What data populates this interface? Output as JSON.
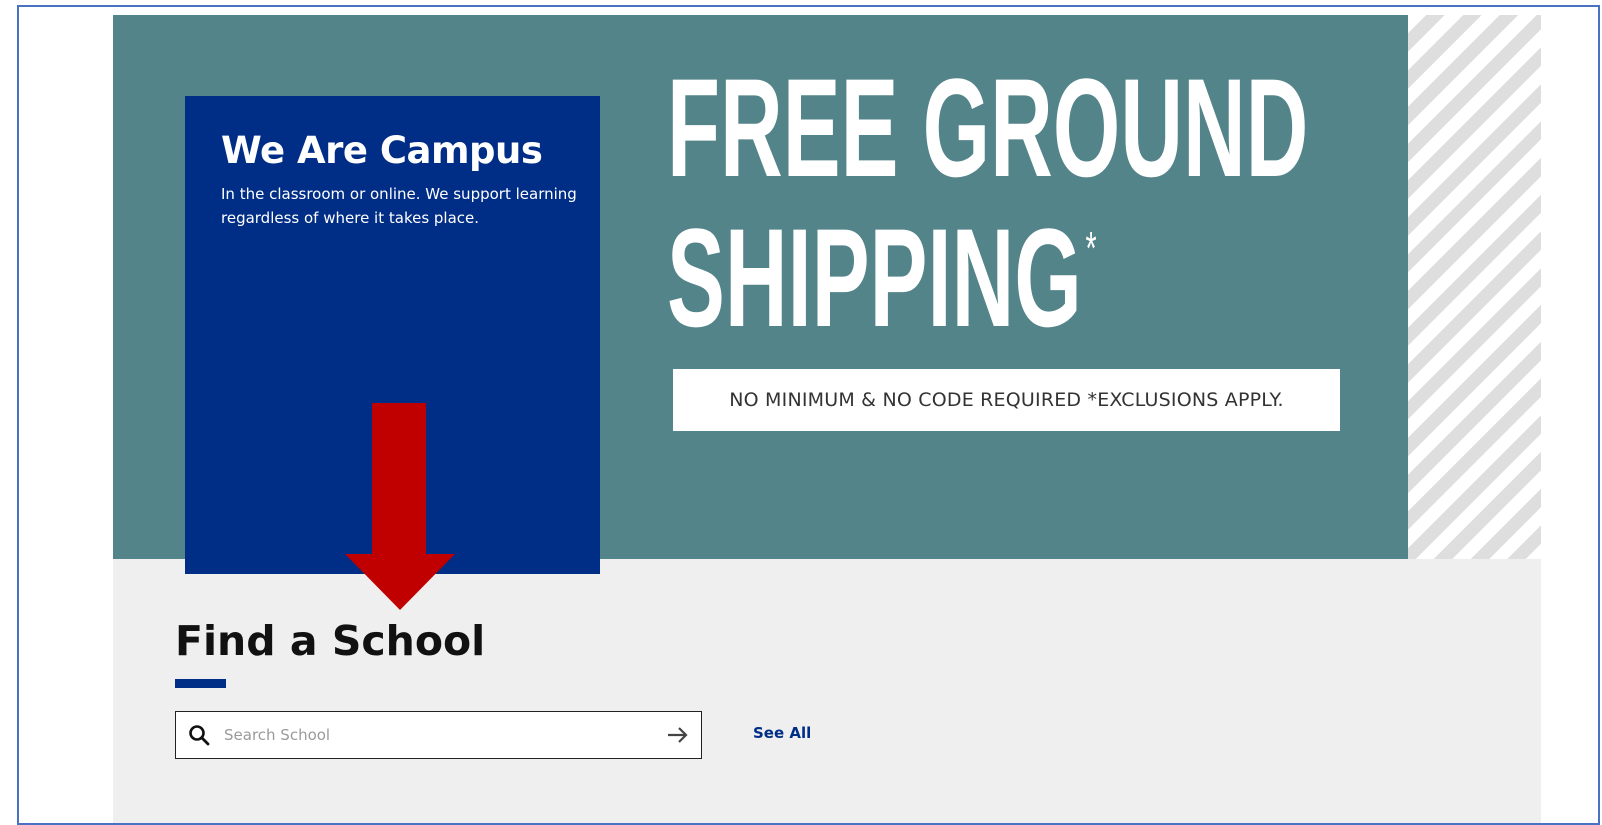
{
  "hero": {
    "card_title": "We Are Campus",
    "card_text": "In the classroom or online. We support learning regardless of where it takes place.",
    "promo_line1": "FREE GROUND",
    "promo_line2": "SHIPPING",
    "promo_asterisk": "*",
    "promo_note": "NO MINIMUM & NO CODE REQUIRED *EXCLUSIONS APPLY."
  },
  "find_school": {
    "title": "Find a School",
    "search_placeholder": "Search School",
    "search_value": "",
    "see_all_label": "See All"
  },
  "colors": {
    "banner_teal": "#538489",
    "campus_blue": "#002e86",
    "annotation_red": "#c00000",
    "section_gray": "#efefef"
  },
  "icons": {
    "search": "search-icon",
    "submit": "arrow-right-icon",
    "annotation": "arrow-down-annotation-icon"
  }
}
